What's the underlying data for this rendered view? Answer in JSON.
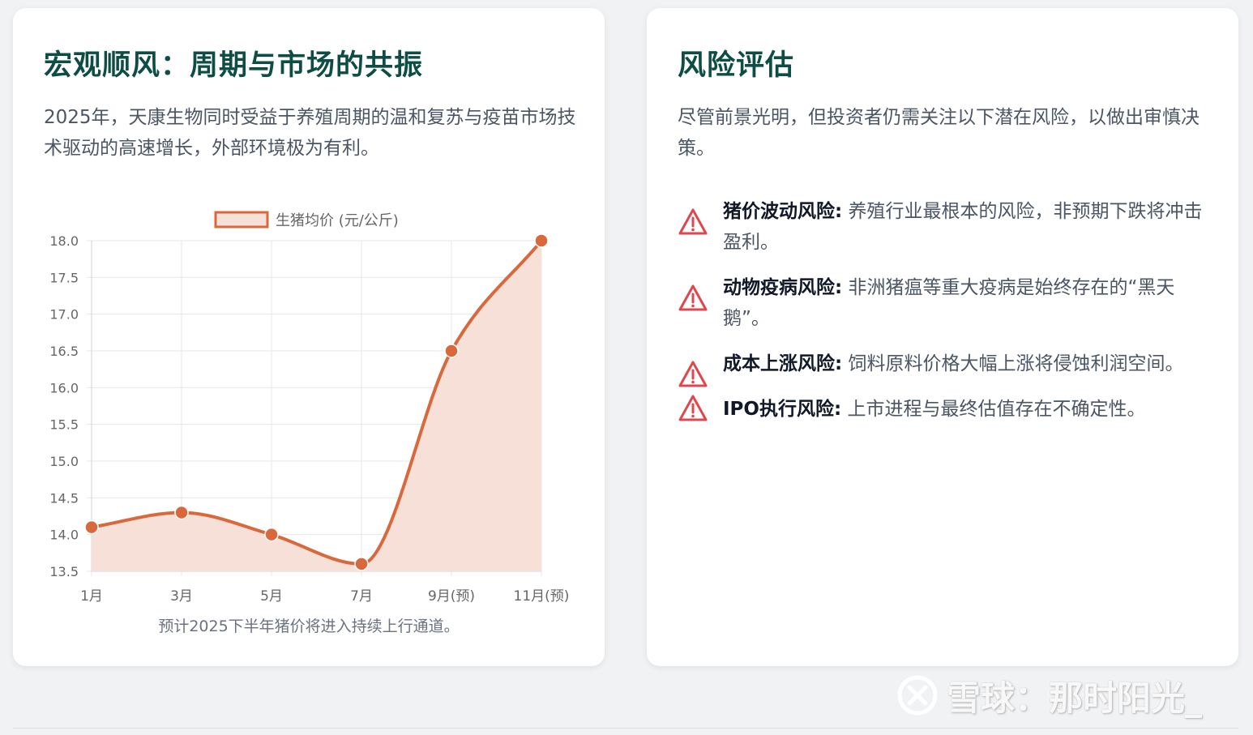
{
  "left_card": {
    "title": "宏观顺风：周期与市场的共振",
    "description": "2025年，天康生物同时受益于养殖周期的温和复苏与疫苗市场技术驱动的高速增长，外部环境极为有利。",
    "caption": "预计2025下半年猪价将进入持续上行通道。"
  },
  "chart_data": {
    "type": "line",
    "categories": [
      "1月",
      "3月",
      "5月",
      "7月",
      "9月(预)",
      "11月(预)"
    ],
    "series": [
      {
        "name": "生猪均价 (元/公斤)",
        "values": [
          14.1,
          14.3,
          14.0,
          13.6,
          16.5,
          18.0
        ]
      }
    ],
    "ylim": [
      13.5,
      18.0
    ],
    "yticks": [
      "18.0",
      "17.5",
      "17.0",
      "16.5",
      "16.0",
      "15.5",
      "15.0",
      "14.5",
      "14.0",
      "13.5"
    ],
    "fill": true,
    "smooth": true,
    "grid": true,
    "legend": "top-center",
    "colors": {
      "line": "#d9693c",
      "fill": "#f7e0d7",
      "grid": "#e5e7eb"
    }
  },
  "right_card": {
    "title": "风险评估",
    "description": "尽管前景光明，但投资者仍需关注以下潜在风险，以做出审慎决策。",
    "risks": [
      {
        "icon": "warning-icon",
        "title": "猪价波动风险:",
        "text": " 养殖行业最根本的风险，非预期下跌将冲击盈利。"
      },
      {
        "icon": "warning-icon",
        "title": "动物疫病风险:",
        "text": " 非洲猪瘟等重大疫病是始终存在的“黑天鹅”。"
      },
      {
        "icon": "warning-icon",
        "title": "成本上涨风险:",
        "text": " 饲料原料价格大幅上涨将侵蚀利润空间。"
      },
      {
        "icon": "warning-icon",
        "title": "IPO执行风险:",
        "text": " 上市进程与最终估值存在不确定性。"
      }
    ],
    "warning_color": "#e0474c"
  },
  "watermark": {
    "text": "雪球：那时阳光_"
  }
}
